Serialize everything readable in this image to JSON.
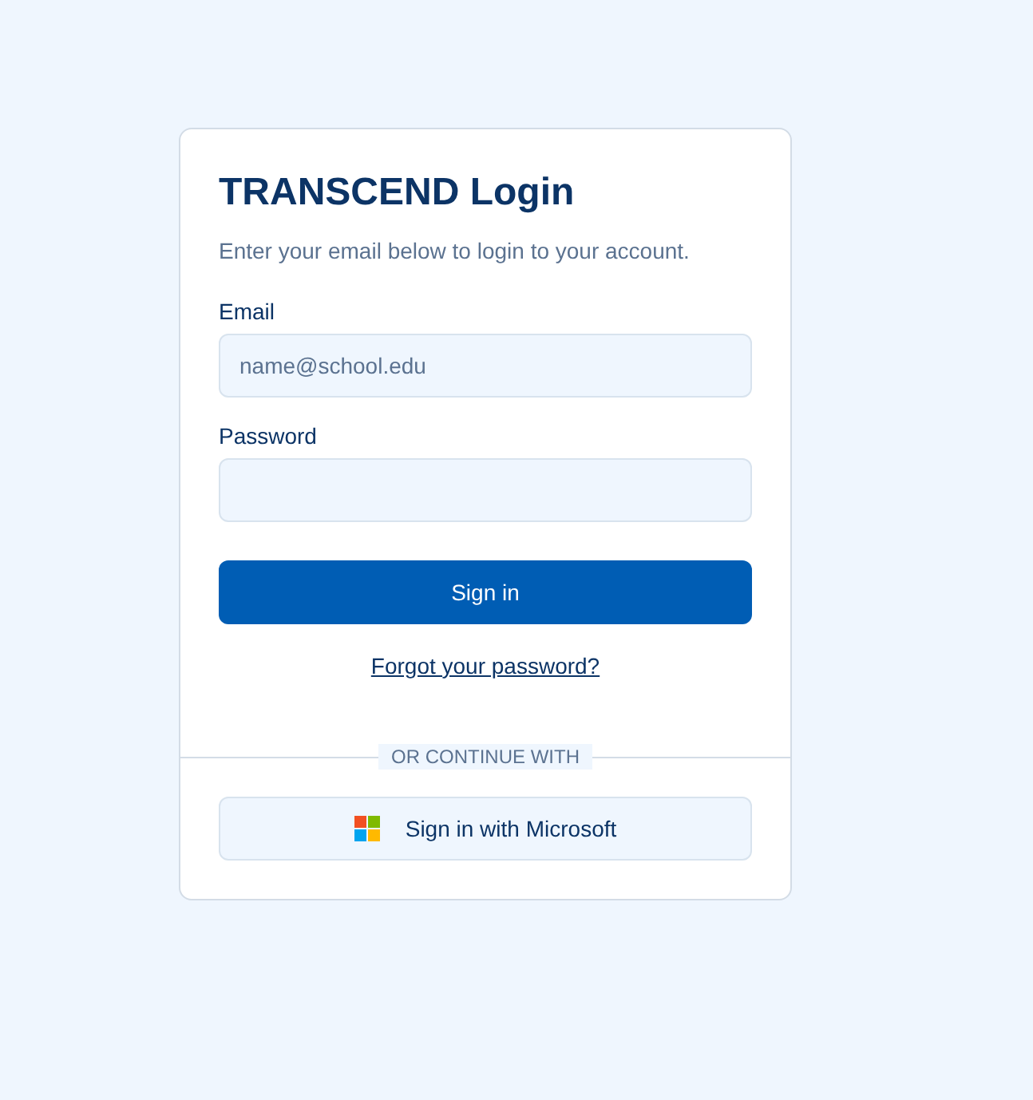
{
  "card": {
    "title": "TRANSCEND Login",
    "subtitle": "Enter your email below to login to your account."
  },
  "fields": [
    {
      "label": "Email",
      "placeholder": "name@school.edu"
    },
    {
      "label": "Password"
    }
  ],
  "sign_in_button": "Sign in",
  "forgot_link": "Forgot your password?",
  "divider_label": "OR CONTINUE WITH",
  "microsoft_button": "Sign in with Microsoft"
}
